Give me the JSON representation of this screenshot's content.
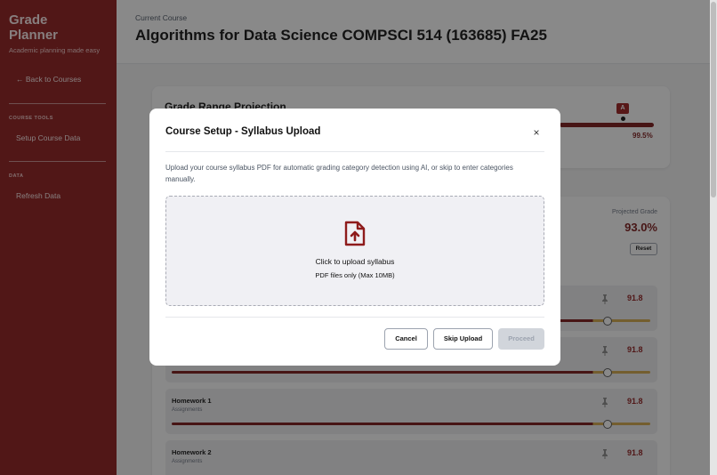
{
  "sidebar": {
    "brand_line1": "Grade",
    "brand_line2": "Planner",
    "tagline": "Academic planning made easy",
    "back_link": "← Back to Courses",
    "section_tools": "COURSE TOOLS",
    "setup_item": "Setup Course Data",
    "section_data": "DATA",
    "refresh_item": "Refresh Data"
  },
  "header": {
    "subtitle": "Current Course",
    "title": "Algorithms for Data Science COMPSCI 514 (163685) FA25"
  },
  "projection": {
    "title": "Grade Range Projection",
    "badge": "A",
    "percent": "99.5%"
  },
  "grade_panel": {
    "label": "Projected Grade",
    "value": "93.0%",
    "reset": "Reset"
  },
  "items": [
    {
      "name": "",
      "category": "",
      "score": "91.8",
      "slider_fraction": 0.92
    },
    {
      "name": "",
      "category": "",
      "score": "91.8",
      "slider_fraction": 0.92
    },
    {
      "name": "Homework 1",
      "category": "Assignments",
      "score": "91.8",
      "slider_fraction": 0.92
    },
    {
      "name": "Homework 2",
      "category": "Assignments",
      "score": "91.8",
      "slider_fraction": 0.92
    }
  ],
  "modal": {
    "title": "Course Setup - Syllabus Upload",
    "close": "×",
    "description": "Upload your course syllabus PDF for automatic grading category detection using AI, or skip to enter categories manually.",
    "drop_main": "Click to upload syllabus",
    "drop_sub": "PDF files only (Max 10MB)",
    "cancel": "Cancel",
    "skip": "Skip Upload",
    "proceed": "Proceed"
  },
  "colors": {
    "brand": "#8e1b1b",
    "accent": "#7a1616",
    "slider_remainder": "#d4a84a"
  }
}
